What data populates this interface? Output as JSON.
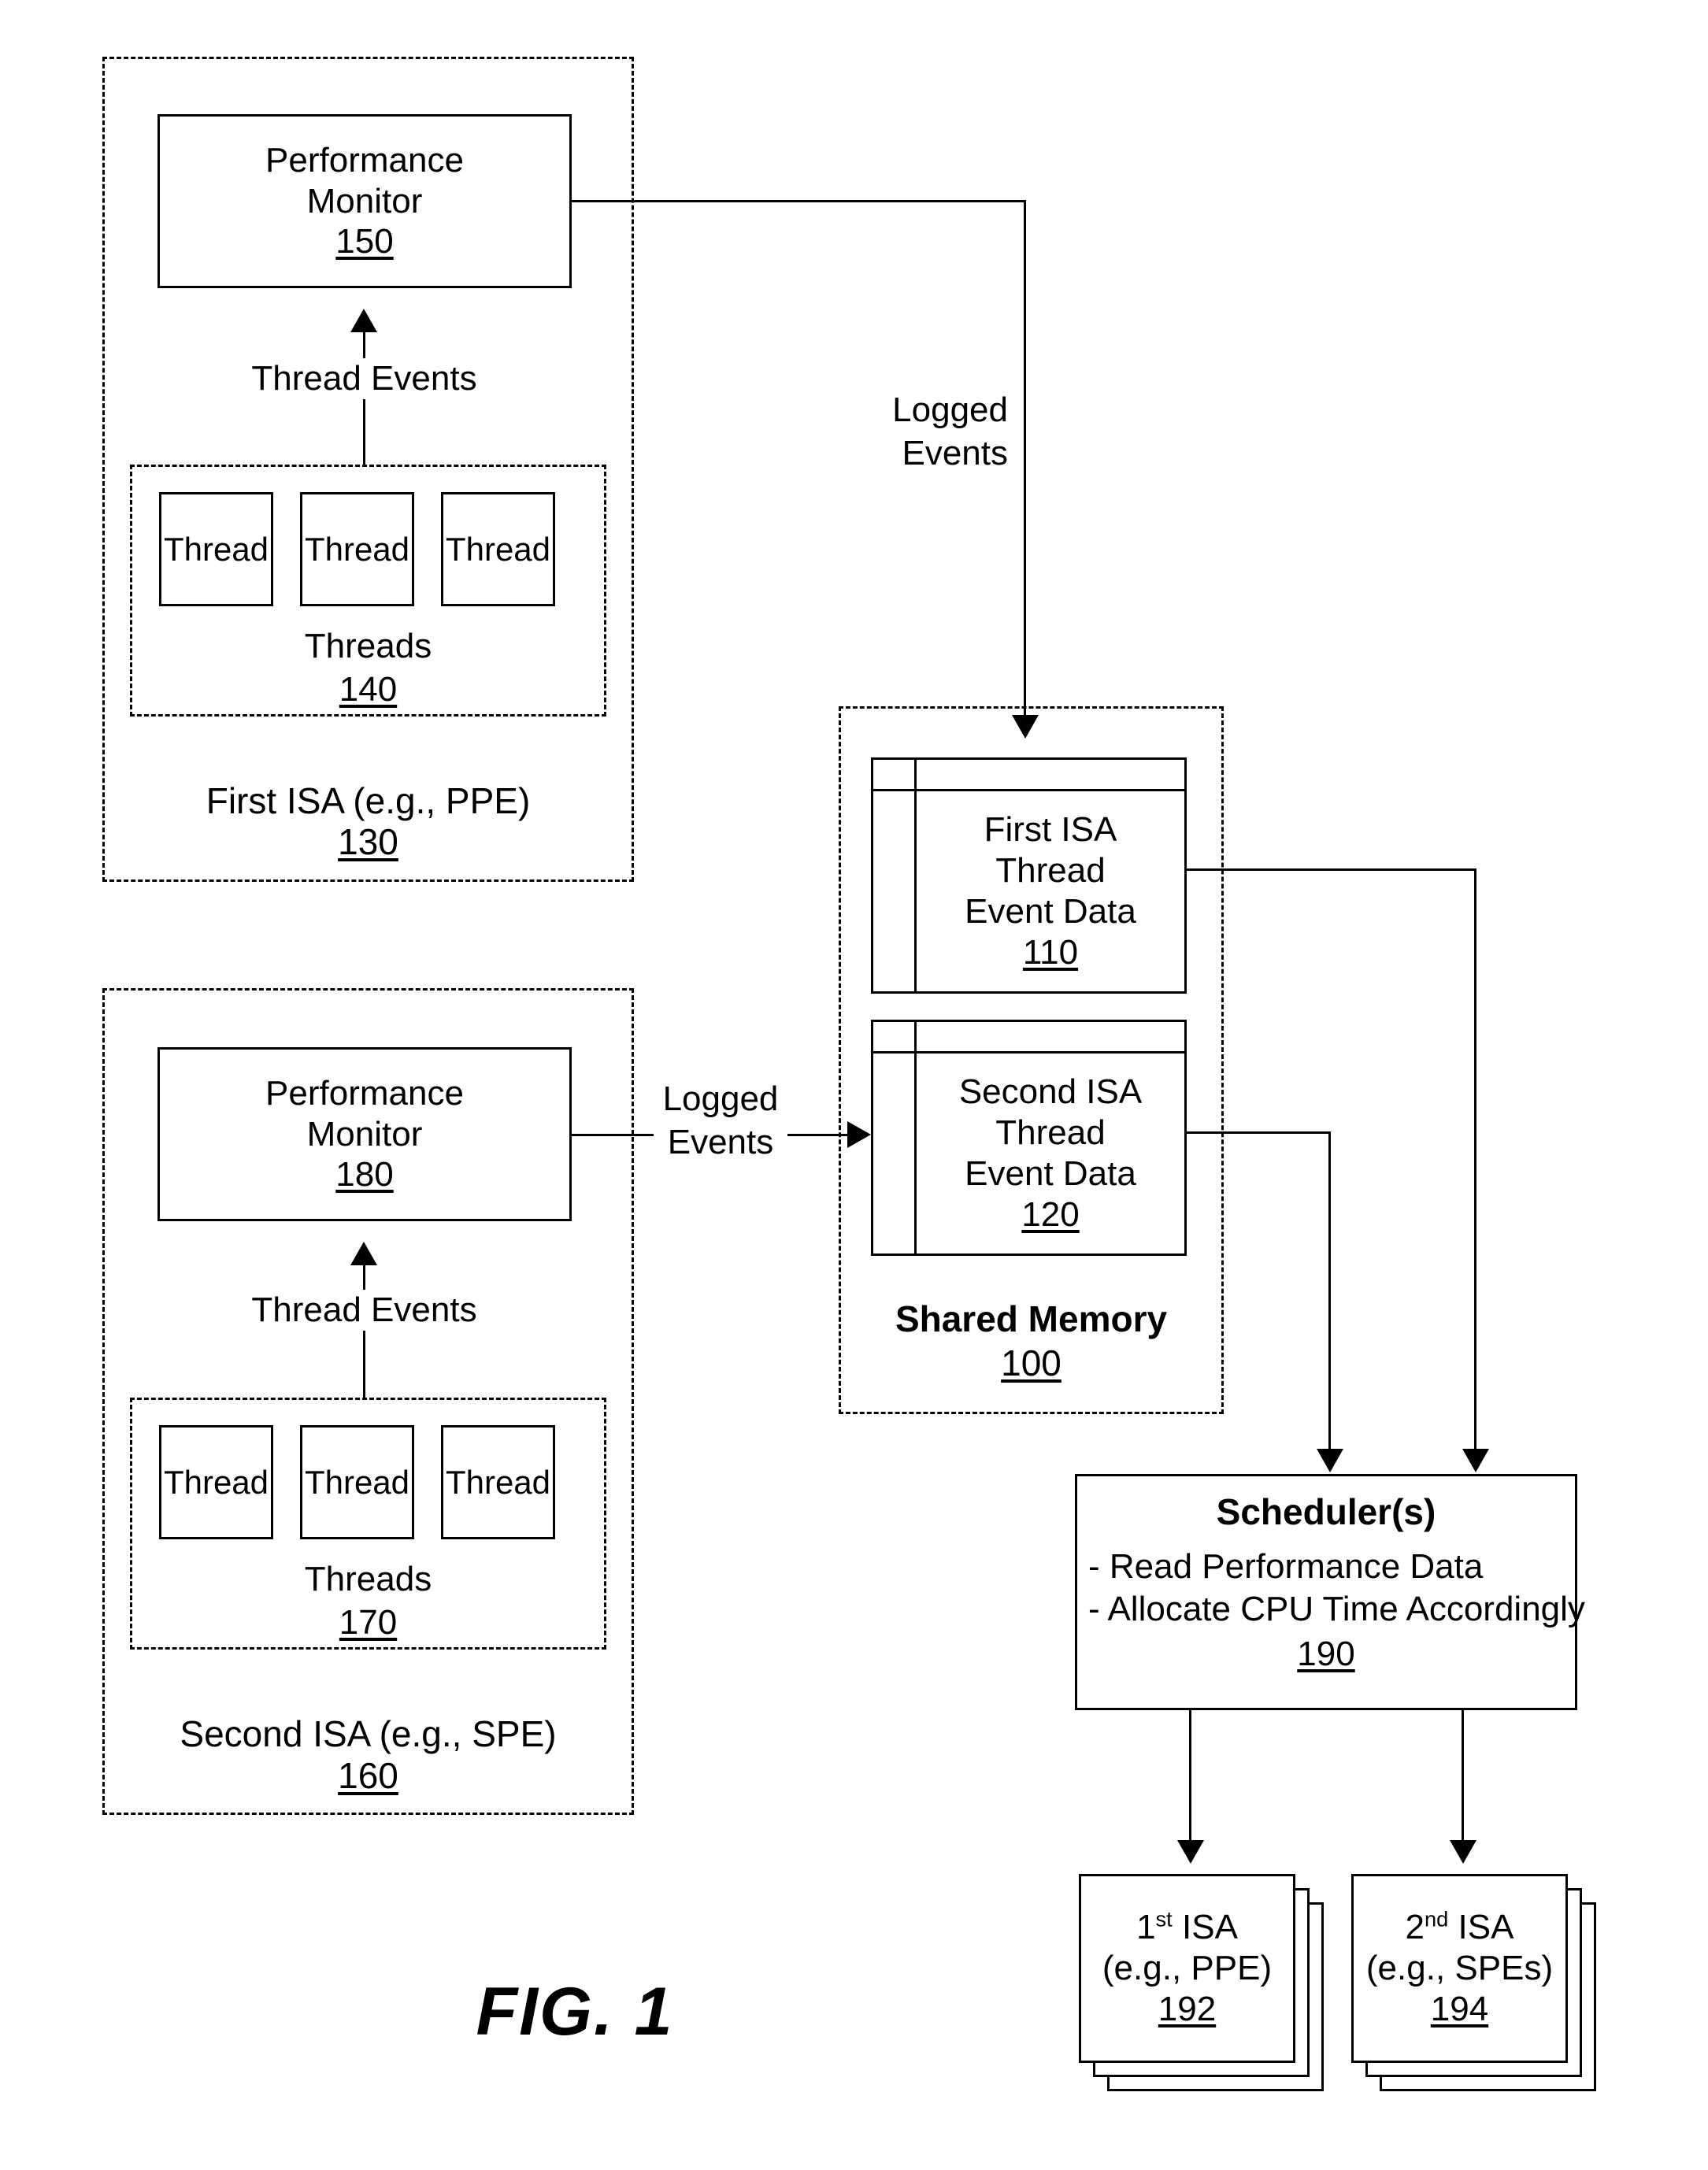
{
  "figure": {
    "caption": "FIG. 1"
  },
  "first_isa_group": {
    "label_line1": "First ISA  (e.g., PPE)",
    "ref": "130",
    "performance_monitor": {
      "line1": "Performance",
      "line2": "Monitor",
      "ref": "150"
    },
    "thread_events_label": "Thread Events",
    "threads_group": {
      "label": "Threads",
      "ref": "140",
      "threads": [
        "Thread",
        "Thread",
        "Thread"
      ]
    }
  },
  "second_isa_group": {
    "label_line1": "Second ISA  (e.g., SPE)",
    "ref": "160",
    "performance_monitor": {
      "line1": "Performance",
      "line2": "Monitor",
      "ref": "180"
    },
    "thread_events_label": "Thread Events",
    "threads_group": {
      "label": "Threads",
      "ref": "170",
      "threads": [
        "Thread",
        "Thread",
        "Thread"
      ]
    }
  },
  "shared_memory": {
    "title": "Shared Memory",
    "ref": "100",
    "first_isa_data": {
      "line1": "First ISA",
      "line2": "Thread",
      "line3": "Event Data",
      "ref": "110"
    },
    "second_isa_data": {
      "line1": "Second ISA",
      "line2": "Thread",
      "line3": "Event Data",
      "ref": "120"
    }
  },
  "connectors": {
    "logged_events_top_line1": "Logged",
    "logged_events_top_line2": "Events",
    "logged_events_mid_line1": "Logged",
    "logged_events_mid_line2": "Events"
  },
  "scheduler": {
    "title": "Scheduler(s)",
    "bullet1": "- Read Performance Data",
    "bullet2": "- Allocate CPU Time Accordingly",
    "ref": "190"
  },
  "targets": {
    "first": {
      "line1_pre": "1",
      "line1_sup": "st",
      "line1_post": " ISA",
      "line2": "(e.g., PPE)",
      "ref": "192"
    },
    "second": {
      "line1_pre": "2",
      "line1_sup": "nd",
      "line1_post": " ISA",
      "line2": "(e.g., SPEs)",
      "ref": "194"
    }
  }
}
